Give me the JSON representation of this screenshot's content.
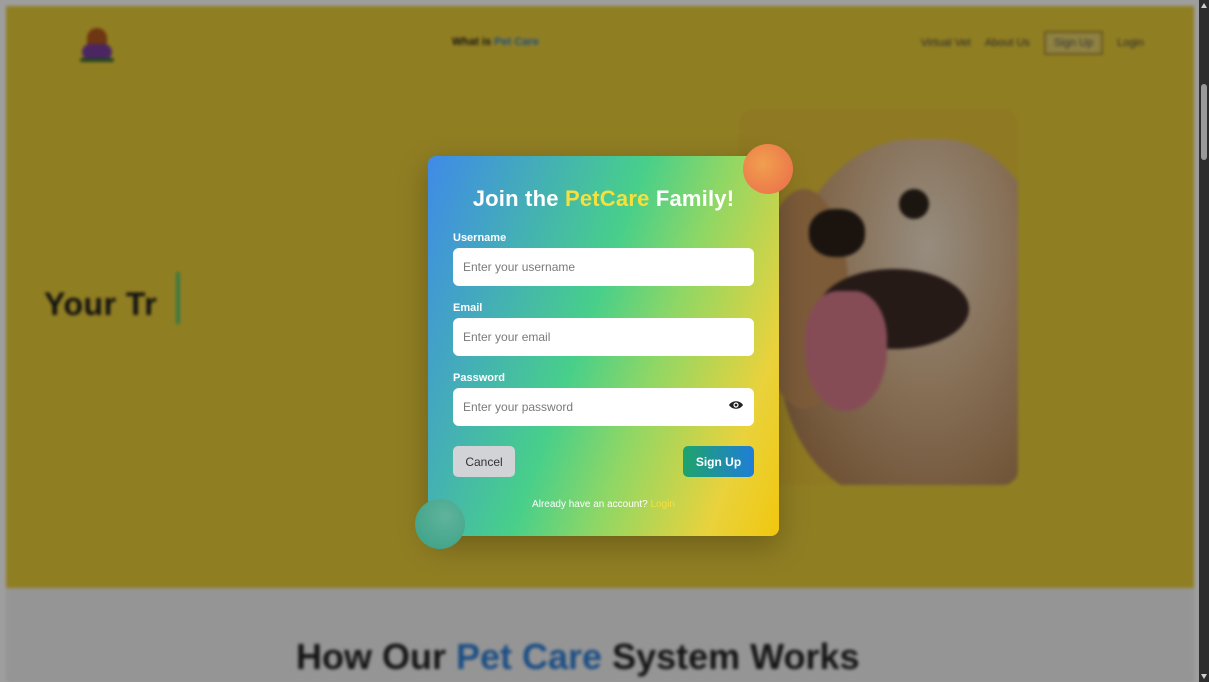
{
  "background": {
    "nav": {
      "center_prefix": "What is ",
      "center_accent": "Pet Care",
      "links": [
        "Virtual Vet",
        "About Us",
        "Sign Up",
        "Login"
      ]
    },
    "hero_title": "Your Tr",
    "section_subtitle_prefix": "How Our ",
    "section_subtitle_accent": "Pet Care",
    "section_subtitle_suffix": " System Works"
  },
  "modal": {
    "title_prefix": "Join the ",
    "title_accent": "PetCare",
    "title_suffix": " Family!",
    "username_label": "Username",
    "username_placeholder": "Enter your username",
    "email_label": "Email",
    "email_placeholder": "Enter your email",
    "password_label": "Password",
    "password_placeholder": "Enter your password",
    "cancel_label": "Cancel",
    "signup_label": "Sign Up",
    "footer_text": "Already have an account? ",
    "footer_link": "Login"
  },
  "colors": {
    "hero_bg": "#e9cc39",
    "modal_gradient_start": "#3f8ae8",
    "modal_gradient_end": "#f1c70f",
    "accent_yellow": "#f5e03c",
    "signup_button": "#1fa36b"
  }
}
